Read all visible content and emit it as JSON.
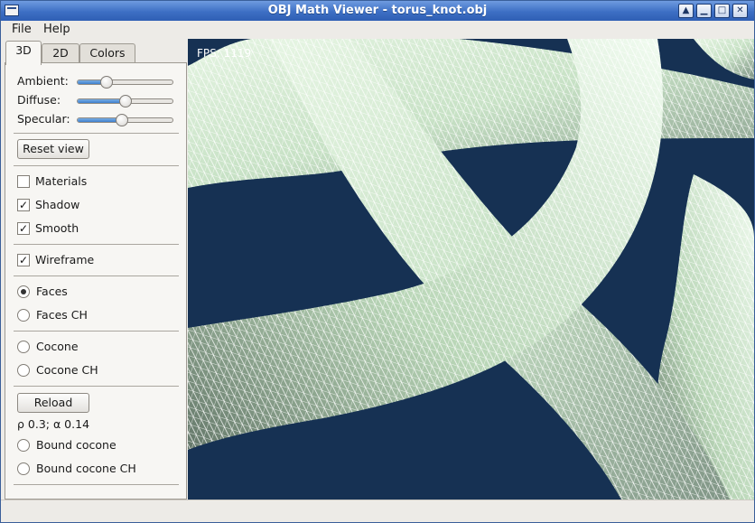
{
  "window": {
    "title": "OBJ Math Viewer - torus_knot.obj"
  },
  "menu": {
    "file": "File",
    "help": "Help"
  },
  "tabs": [
    "3D",
    "2D",
    "Colors"
  ],
  "sliders": [
    {
      "label": "Ambient:",
      "value": 0.3
    },
    {
      "label": "Diffuse:",
      "value": 0.5
    },
    {
      "label": "Specular:",
      "value": 0.47
    }
  ],
  "buttons": {
    "reset_view": "Reset view",
    "reload": "Reload"
  },
  "checks": [
    {
      "label": "Materials",
      "checked": false
    },
    {
      "label": "Shadow",
      "checked": true
    },
    {
      "label": "Smooth",
      "checked": true
    },
    {
      "label": "Wireframe",
      "checked": true
    }
  ],
  "radios": [
    {
      "label": "Faces",
      "checked": true
    },
    {
      "label": "Faces CH",
      "checked": false
    },
    {
      "label": "Cocone",
      "checked": false
    },
    {
      "label": "Cocone CH",
      "checked": false
    },
    {
      "label": "Bound cocone",
      "checked": false
    },
    {
      "label": "Bound cocone CH",
      "checked": false
    }
  ],
  "params": "ρ 0.3; α 0.14",
  "viewport": {
    "fps": "FPS: 1119"
  },
  "colors": {
    "viewport_bg": "#163153",
    "mesh_fill": "#cfe8cf",
    "wire": "#ffffff",
    "accent": "#3e7fcc"
  },
  "icons": {
    "window_buttons": [
      "up-arrow-icon",
      "minimize-icon",
      "maximize-icon",
      "close-icon"
    ]
  }
}
